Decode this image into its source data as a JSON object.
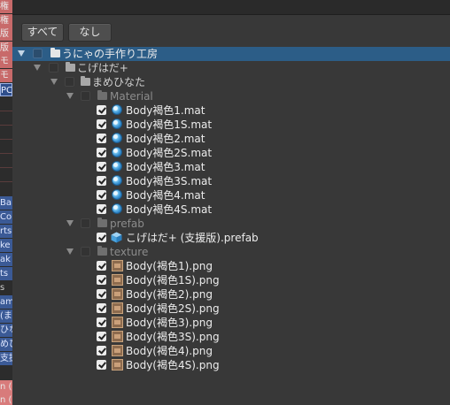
{
  "left_strip": {
    "fragments": [
      "権",
      "権",
      "版",
      "版",
      "モ",
      "モ",
      "PC",
      "Ba",
      "Co",
      "rts",
      "ke",
      "ak",
      "ts",
      "s",
      "am",
      "(ま",
      "ひな",
      "めひ",
      "支援",
      "n (",
      "n ("
    ]
  },
  "buttons": {
    "all_label": "すべて",
    "none_label": "なし"
  },
  "tree": {
    "root": {
      "label": "うにゃの手作り工房",
      "checked": false
    },
    "level1": {
      "label": "こげはだ+",
      "checked": false
    },
    "level2": {
      "label": "まめひなた",
      "checked": false
    },
    "material_folder": {
      "label": "Material",
      "checked": false
    },
    "materials": [
      {
        "label": "Body褐色1.mat",
        "checked": true
      },
      {
        "label": "Body褐色1S.mat",
        "checked": true
      },
      {
        "label": "Body褐色2.mat",
        "checked": true
      },
      {
        "label": "Body褐色2S.mat",
        "checked": true
      },
      {
        "label": "Body褐色3.mat",
        "checked": true
      },
      {
        "label": "Body褐色3S.mat",
        "checked": true
      },
      {
        "label": "Body褐色4.mat",
        "checked": true
      },
      {
        "label": "Body褐色4S.mat",
        "checked": true
      }
    ],
    "prefab_folder": {
      "label": "prefab",
      "checked": false
    },
    "prefabs": [
      {
        "label": "こげはだ+ (支援版).prefab",
        "checked": true
      }
    ],
    "texture_folder": {
      "label": "texture",
      "checked": false
    },
    "textures": [
      {
        "label": "Body(褐色1).png",
        "checked": true
      },
      {
        "label": "Body(褐色1S).png",
        "checked": true
      },
      {
        "label": "Body(褐色2).png",
        "checked": true
      },
      {
        "label": "Body(褐色2S).png",
        "checked": true
      },
      {
        "label": "Body(褐色3).png",
        "checked": true
      },
      {
        "label": "Body(褐色3S).png",
        "checked": true
      },
      {
        "label": "Body(褐色4).png",
        "checked": true
      },
      {
        "label": "Body(褐色4S).png",
        "checked": true
      }
    ]
  }
}
